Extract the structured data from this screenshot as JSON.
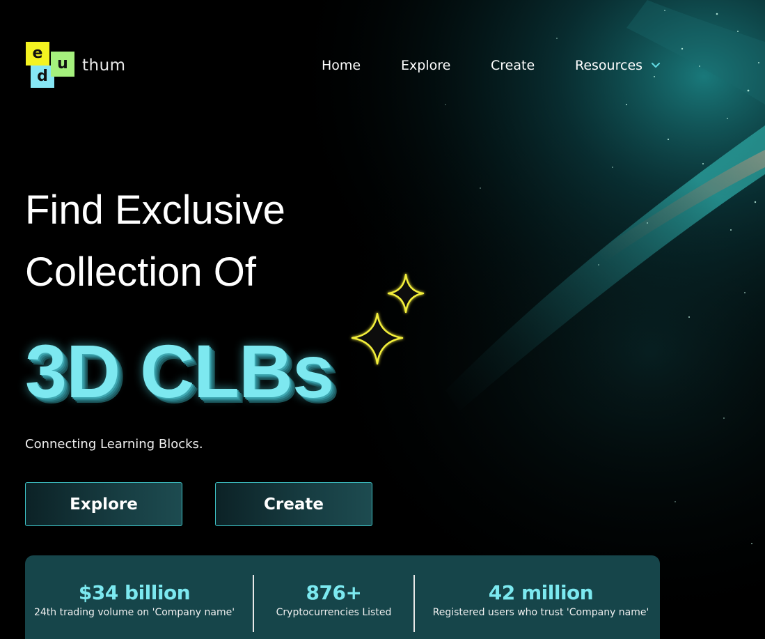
{
  "logo": {
    "block_e": "e",
    "block_d": "d",
    "block_u": "u",
    "word": "thum",
    "colors": {
      "e": "#f4f321",
      "d": "#86e6f4",
      "u": "#a5f07d"
    }
  },
  "nav": {
    "items": [
      {
        "label": "Home"
      },
      {
        "label": "Explore"
      },
      {
        "label": "Create"
      },
      {
        "label": "Resources",
        "icon": "chevron-down-icon"
      }
    ]
  },
  "hero": {
    "title_line1": "Find Exclusive",
    "title_line2": "Collection Of",
    "highlight": "3D CLBs",
    "subtitle": "Connecting Learning Blocks.",
    "accent_color": "#7de8f0",
    "sparkle_color": "#f4ef3a"
  },
  "buttons": {
    "explore_label": "Explore",
    "create_label": "Create"
  },
  "stats": [
    {
      "value": "$34 billion",
      "label": "24th trading volume on 'Company name'"
    },
    {
      "value": "876+",
      "label": "Cryptocurrencies Listed"
    },
    {
      "value": "42 million",
      "label": "Registered users who trust 'Company name'"
    }
  ]
}
